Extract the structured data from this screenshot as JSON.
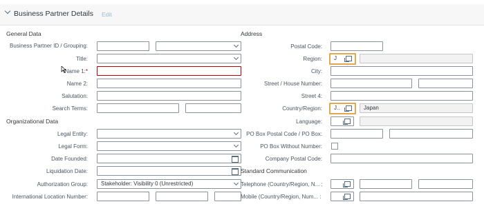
{
  "header": {
    "title": "Business Partner Details",
    "edit_label": "Edit"
  },
  "general": {
    "section_title": "General Data",
    "bp_id_label": "Business Partner ID / Grouping:",
    "title_label": "Title:",
    "name1_label": "Name 1:",
    "name1_required": "*",
    "name2_label": "Name 2:",
    "salutation_label": "Salutation:",
    "search_terms_label": "Search Terms:"
  },
  "org": {
    "section_title": "Organizational Data",
    "legal_entity_label": "Legal Entity:",
    "legal_form_label": "Legal Form:",
    "date_founded_label": "Date Founded:",
    "liquidation_date_label": "Liquidation Date:",
    "auth_group_label": "Authorization Group:",
    "auth_group_value": "Stakeholder: Visibility 0 (Unrestricted)",
    "intl_location_label": "International Location Number:"
  },
  "address": {
    "section_title": "Address",
    "postal_code_label": "Postal Code:",
    "region_label": "Region:",
    "region_value": "J",
    "city_label": "City:",
    "street_house_label": "Street / House Number:",
    "street4_label": "Street 4:",
    "country_label": "Country/Region:",
    "country_value": "J..",
    "country_desc": "Japan",
    "language_label": "Language:",
    "po_box_label": "PO Box Postal Code / PO Box:",
    "po_box_without_number_label": "PO Box Without Number:",
    "company_postal_label": "Company Postal Code:"
  },
  "communication": {
    "section_title": "Standard Communication",
    "telephone_label": "Telephone (Country/Region, N... :",
    "mobile_label": "Mobile (Country/Region, Num... :"
  }
}
